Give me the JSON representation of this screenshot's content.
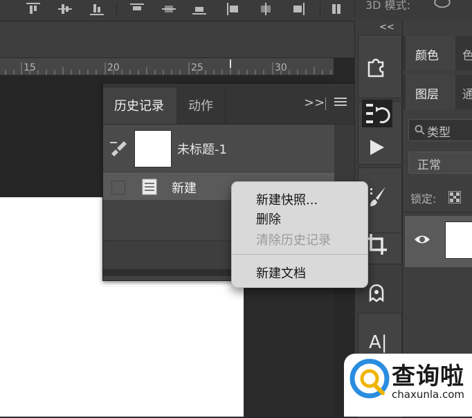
{
  "toolbar": {
    "label_3d": "3D 模式:"
  },
  "ruler": {
    "ticks": [
      "15",
      "20",
      "25",
      "30"
    ]
  },
  "history_panel": {
    "tabs": [
      {
        "label": "历史记录",
        "active": true
      },
      {
        "label": "动作",
        "active": false
      }
    ],
    "expand_label": ">>",
    "snapshot_label": "未标题-1",
    "items": [
      {
        "label": "新建"
      }
    ]
  },
  "context_menu": {
    "items": [
      {
        "label": "新建快照...",
        "enabled": true
      },
      {
        "label": "删除",
        "enabled": true
      },
      {
        "label": "清除历史记录",
        "enabled": false
      },
      {
        "label": "新建文档",
        "enabled": true
      }
    ]
  },
  "tools_panel": {
    "collapse_label": "<<",
    "tools": [
      "puzzle-icon",
      "history-brush-icon",
      "play-icon",
      "brush-icon",
      "crop-icon",
      "puppet-icon",
      "text-tool-icon"
    ],
    "text_tool_label": "A|"
  },
  "right_panel": {
    "color_tabs": [
      "颜色",
      "色"
    ],
    "layer_tabs": [
      "图层",
      "通"
    ],
    "search_placeholder": "类型",
    "blend_mode": "正常",
    "lock_label": "锁定:"
  },
  "watermark": {
    "title": "查询啦",
    "url": "chaxunla.com"
  },
  "colors": {
    "canvas": "#ffffff",
    "menu": "#d9d9d9",
    "selected_row": "#5a5a5a"
  }
}
